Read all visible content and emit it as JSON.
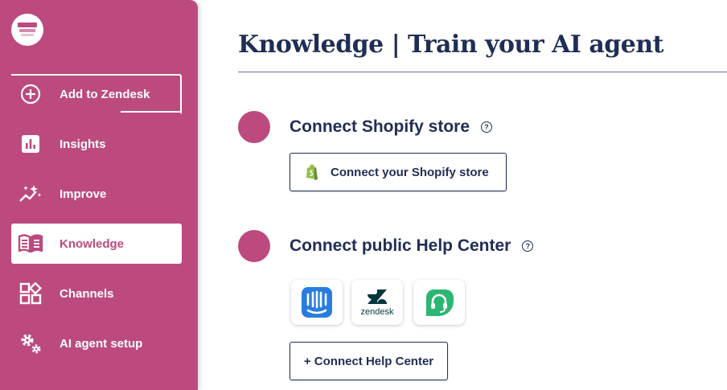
{
  "sidebar": {
    "items": [
      {
        "label": "Add to Zendesk",
        "icon": "plus-circle-icon"
      },
      {
        "label": "Insights",
        "icon": "bar-chart-icon"
      },
      {
        "label": "Improve",
        "icon": "sparkle-icon"
      },
      {
        "label": "Knowledge",
        "icon": "book-icon",
        "active": true
      },
      {
        "label": "Channels",
        "icon": "grid-icon"
      },
      {
        "label": "AI agent setup",
        "icon": "gears-icon"
      }
    ]
  },
  "page": {
    "title": "Knowledge | Train your AI agent"
  },
  "shopify": {
    "title": "Connect Shopify store",
    "help": "?",
    "button_label": "Connect your Shopify store"
  },
  "helpcenter": {
    "title": "Connect public Help Center",
    "help": "?",
    "providers": [
      {
        "name": "intercom",
        "icon": "intercom-icon"
      },
      {
        "name": "zendesk",
        "icon": "zendesk-icon"
      },
      {
        "name": "gorgias",
        "icon": "headset-icon"
      }
    ],
    "button_label": "+ Connect Help Center"
  },
  "colors": {
    "brand": "#bc4a7e",
    "navy": "#1f2e55",
    "intercom": "#2a7dde",
    "headset": "#2bb673"
  }
}
